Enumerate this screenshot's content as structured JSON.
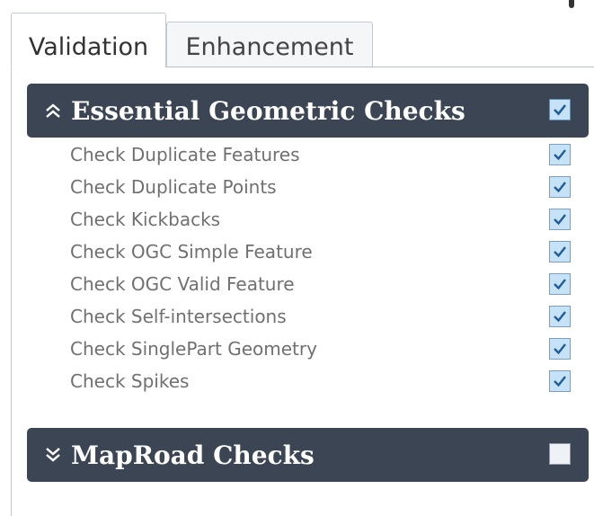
{
  "tabs": [
    {
      "label": "Validation",
      "active": true
    },
    {
      "label": "Enhancement",
      "active": false
    }
  ],
  "groups": [
    {
      "title": "Essential Geometric Checks",
      "expanded": true,
      "chevron_icon": "chevron-double-up-icon",
      "checked": true,
      "items": [
        {
          "label": "Check Duplicate Features",
          "checked": true
        },
        {
          "label": "Check Duplicate Points",
          "checked": true
        },
        {
          "label": "Check Kickbacks",
          "checked": true
        },
        {
          "label": "Check OGC Simple Feature",
          "checked": true
        },
        {
          "label": "Check OGC Valid Feature",
          "checked": true
        },
        {
          "label": "Check Self-intersections",
          "checked": true
        },
        {
          "label": "Check SinglePart Geometry",
          "checked": true
        },
        {
          "label": "Check Spikes",
          "checked": true
        }
      ]
    },
    {
      "title": "MapRoad Checks",
      "expanded": false,
      "chevron_icon": "chevron-double-down-icon",
      "checked": false
    }
  ],
  "colors": {
    "header_bg": "#3c4554",
    "checkbox_fill": "#c6e2f6",
    "checkmark": "#1f5c99",
    "item_text": "#707070"
  }
}
